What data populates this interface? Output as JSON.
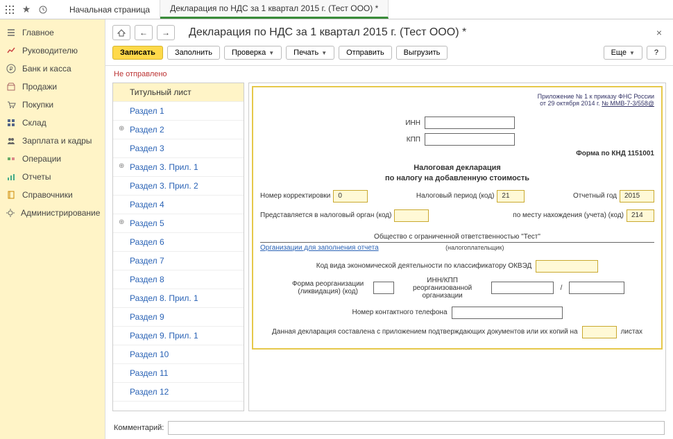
{
  "titlebar": {
    "tabs": [
      {
        "label": "Начальная страница",
        "active": false
      },
      {
        "label": "Декларация по НДС за 1 квартал 2015 г. (Тест ООО) *",
        "active": true
      }
    ]
  },
  "left_nav": [
    {
      "icon": "menu",
      "label": "Главное"
    },
    {
      "icon": "chart",
      "label": "Руководителю"
    },
    {
      "icon": "ruble",
      "label": "Банк и касса"
    },
    {
      "icon": "store",
      "label": "Продажи"
    },
    {
      "icon": "cart",
      "label": "Покупки"
    },
    {
      "icon": "grid",
      "label": "Склад"
    },
    {
      "icon": "people",
      "label": "Зарплата и кадры"
    },
    {
      "icon": "ops",
      "label": "Операции"
    },
    {
      "icon": "report",
      "label": "Отчеты"
    },
    {
      "icon": "book",
      "label": "Справочники"
    },
    {
      "icon": "gear",
      "label": "Администрирование"
    }
  ],
  "page": {
    "title": "Декларация по НДС за 1 квартал 2015 г. (Тест ООО) *"
  },
  "actions": {
    "save": "Записать",
    "fill": "Заполнить",
    "check": "Проверка",
    "print": "Печать",
    "send": "Отправить",
    "export": "Выгрузить",
    "more": "Еще",
    "help": "?"
  },
  "status": "Не отправлено",
  "sections": [
    {
      "label": "Титульный лист",
      "expand": "",
      "active": true
    },
    {
      "label": "Раздел 1",
      "expand": ""
    },
    {
      "label": "Раздел 2",
      "expand": "⊕"
    },
    {
      "label": "Раздел 3",
      "expand": ""
    },
    {
      "label": "Раздел 3. Прил. 1",
      "expand": "⊕"
    },
    {
      "label": "Раздел 3. Прил. 2",
      "expand": ""
    },
    {
      "label": "Раздел 4",
      "expand": ""
    },
    {
      "label": "Раздел 5",
      "expand": "⊕"
    },
    {
      "label": "Раздел 6",
      "expand": ""
    },
    {
      "label": "Раздел 7",
      "expand": ""
    },
    {
      "label": "Раздел 8",
      "expand": ""
    },
    {
      "label": "Раздел 8. Прил. 1",
      "expand": ""
    },
    {
      "label": "Раздел 9",
      "expand": ""
    },
    {
      "label": "Раздел 9. Прил. 1",
      "expand": ""
    },
    {
      "label": "Раздел 10",
      "expand": ""
    },
    {
      "label": "Раздел 11",
      "expand": ""
    },
    {
      "label": "Раздел 12",
      "expand": ""
    }
  ],
  "form": {
    "appendix_line1": "Приложение № 1 к приказу ФНС России",
    "appendix_line2_pre": "от 29 октября 2014 г. ",
    "appendix_link": "№ ММВ-7-3/558@",
    "inn_label": "ИНН",
    "kpp_label": "КПП",
    "knd_label": "Форма по КНД 1151001",
    "heading1": "Налоговая декларация",
    "heading2": "по налогу на добавленную стоимость",
    "corr_label": "Номер корректировки",
    "corr_value": "0",
    "period_label": "Налоговый период (код)",
    "period_value": "21",
    "year_label": "Отчетный год",
    "year_value": "2015",
    "organ_label": "Представляется в налоговый орган (код)",
    "organ_value": "",
    "loc_label": "по месту нахождения (учета) (код)",
    "loc_value": "214",
    "org_name": "Общество с ограниченной ответственностью \"Тест\"",
    "org_link": "Организации для заполнения отчета",
    "taxpayer_sub": "(налогоплательщик)",
    "okved_label": "Код вида экономической деятельности по классификатору ОКВЭД",
    "reorg_form_label": "Форма реорганизации (ликвидация) (код)",
    "reorg_inn_label": "ИНН/КПП реорганизованной организации",
    "slash": "/",
    "phone_label": "Номер контактного телефона",
    "attach_pre": "Данная декларация составлена с приложением подтверждающих документов или их копий на",
    "attach_post": "листах"
  },
  "comment": {
    "label": "Комментарий:",
    "value": ""
  }
}
